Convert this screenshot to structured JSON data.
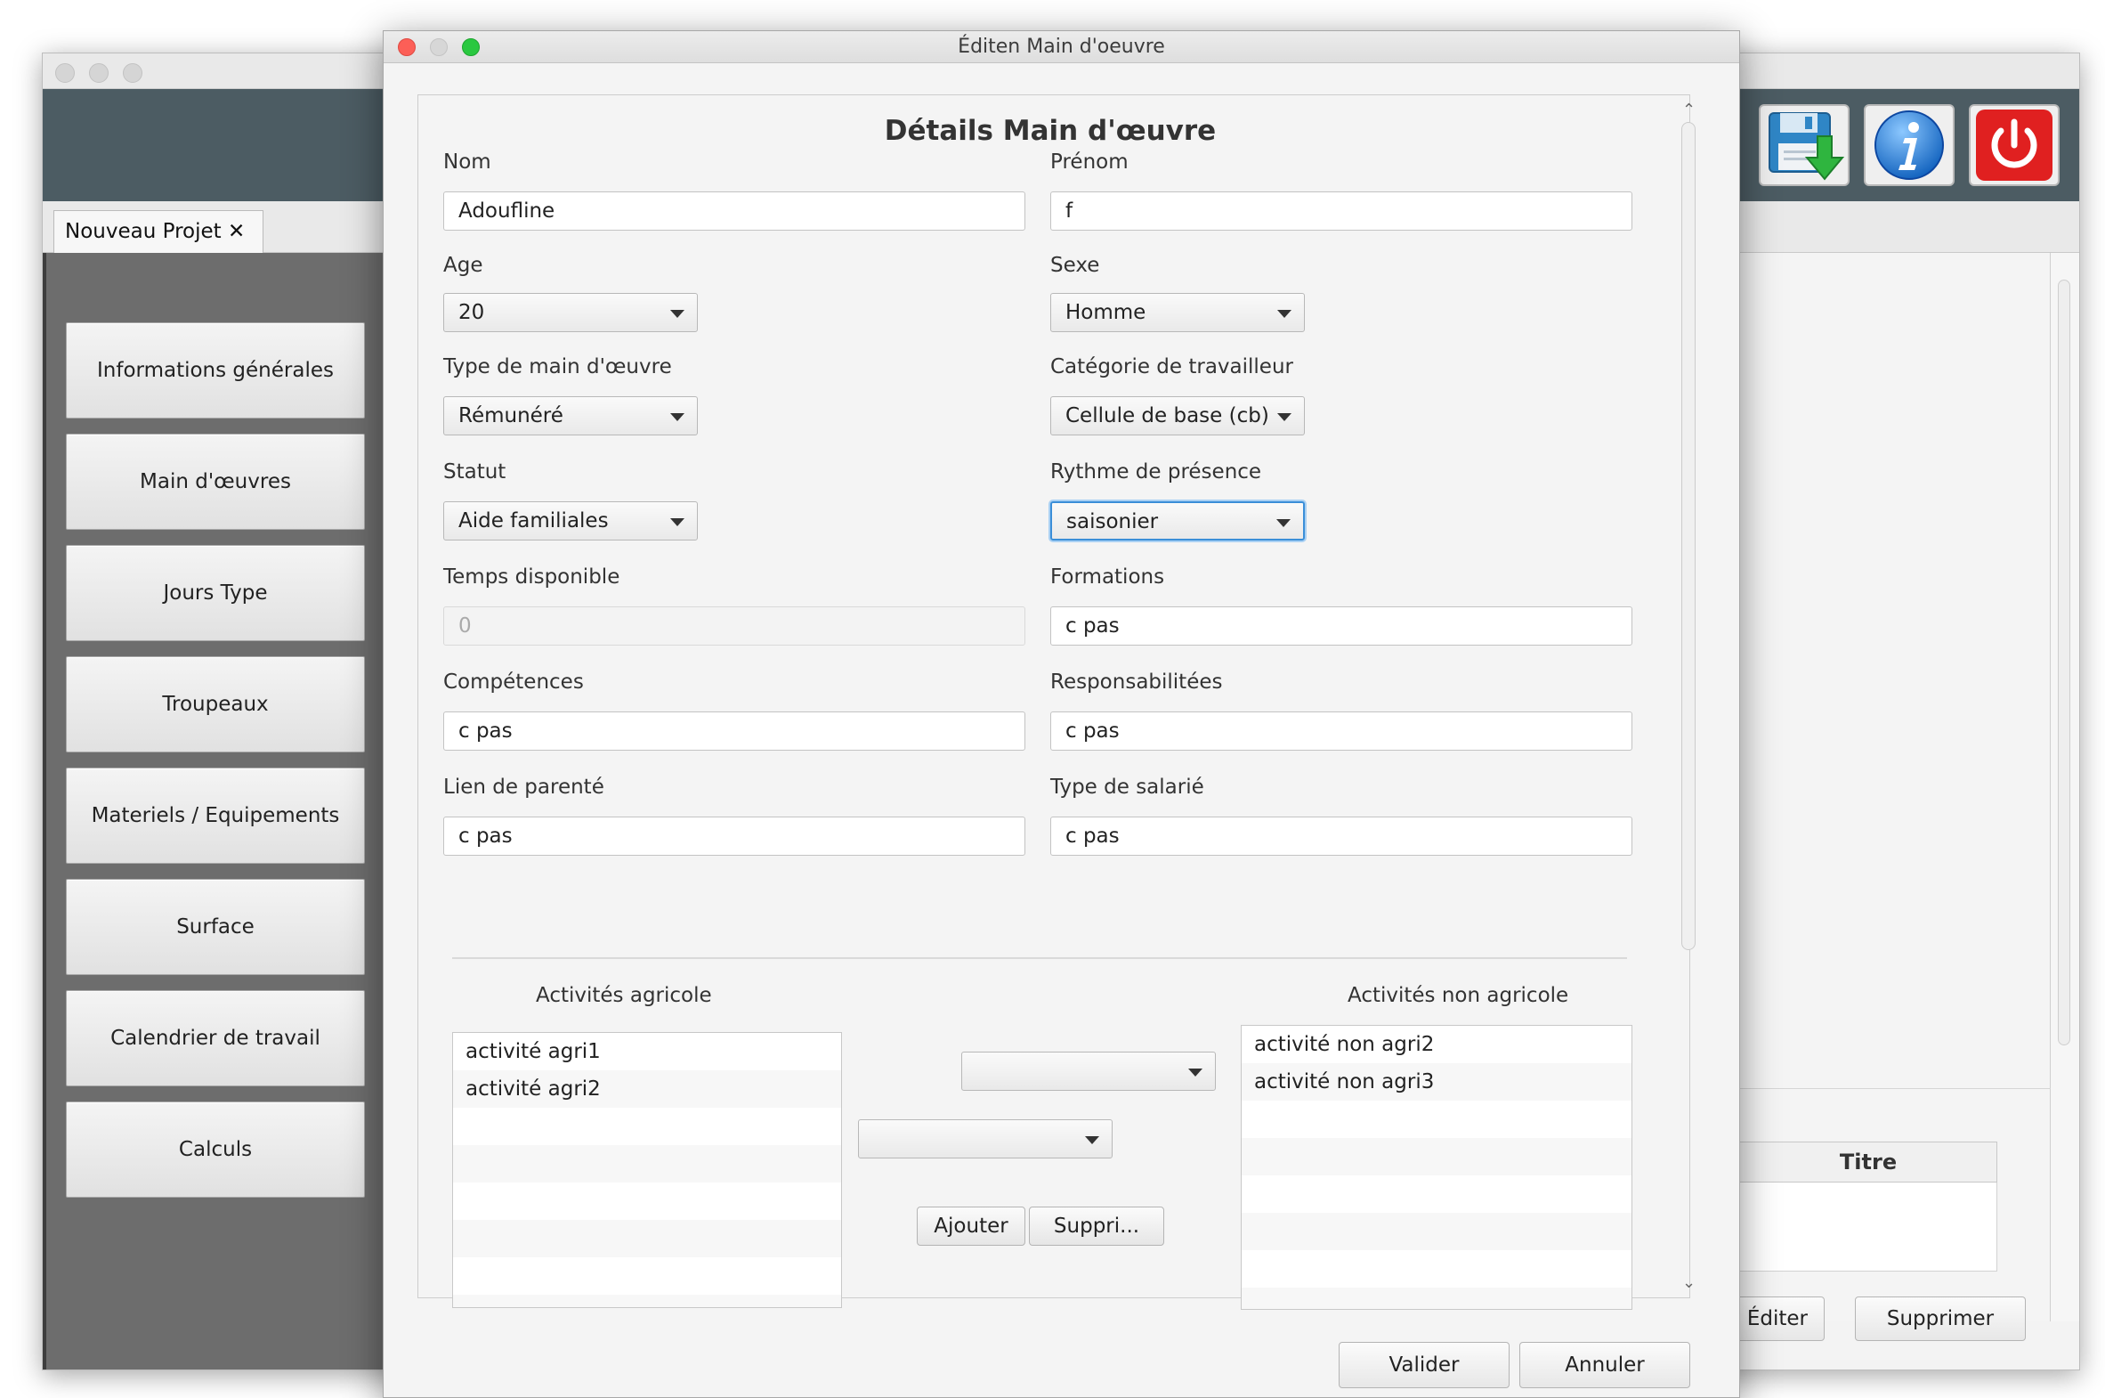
{
  "dialog": {
    "title": "Éditen Main d'oeuvre",
    "heading": "Détails Main d'œuvre"
  },
  "fields": {
    "nom": {
      "label": "Nom",
      "value": "Adoufline"
    },
    "prenom": {
      "label": "Prénom",
      "value": "f"
    },
    "age": {
      "label": "Age",
      "value": "20"
    },
    "sexe": {
      "label": "Sexe",
      "value": "Homme"
    },
    "type_main": {
      "label": "Type de main d'œuvre",
      "value": "Rémunéré"
    },
    "categorie": {
      "label": "Catégorie de travailleur",
      "value": "Cellule de base (cb)"
    },
    "statut": {
      "label": "Statut",
      "value": "Aide familiales"
    },
    "rythme": {
      "label": "Rythme de présence",
      "value": "saisonier"
    },
    "temps": {
      "label": "Temps disponible",
      "value": "0"
    },
    "formations": {
      "label": "Formations",
      "value": "c pas"
    },
    "competences": {
      "label": "Compétences",
      "value": "c pas"
    },
    "responsabilites": {
      "label": "Responsabilitées",
      "value": "c pas"
    },
    "lien": {
      "label": "Lien de parenté",
      "value": "c pas"
    },
    "type_salarie": {
      "label": "Type de salarié",
      "value": "c pas"
    }
  },
  "activities": {
    "agri_label": "Activités agricole",
    "non_agri_label": "Activités non agricole",
    "agri_items": [
      "activité agri1",
      "activité agri2"
    ],
    "non_agri_items": [
      "activité non agri2",
      "activité non agri3"
    ],
    "add_label": "Ajouter",
    "remove_label": "Suppri..."
  },
  "footer": {
    "ok_label": "Valider",
    "cancel_label": "Annuler"
  },
  "background": {
    "project_tab": "Nouveau Projet ✕",
    "nav": [
      "Informations générales",
      "Main d'œuvres",
      "Jours Type",
      "Troupeaux",
      "Materiels / Equipements",
      "Surface",
      "Calendrier de travail",
      "Calculs"
    ],
    "table_header": "Titre",
    "edit_label": "Éditer",
    "delete_label": "Supprimer"
  },
  "colors": {
    "close": "#fc5f57",
    "minimize": "#d7d7d7",
    "zoom": "#2ac840",
    "focus": "#3a8ed8",
    "toolbar": "#4c5c63"
  },
  "icons": {
    "save": "save-icon",
    "info": "info-icon",
    "power": "power-icon"
  }
}
